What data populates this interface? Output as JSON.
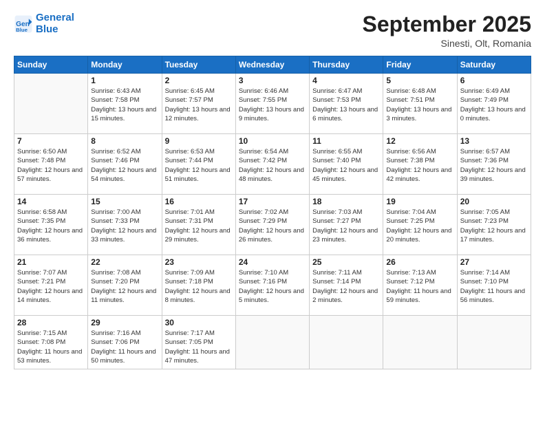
{
  "header": {
    "logo_line1": "General",
    "logo_line2": "Blue",
    "month_title": "September 2025",
    "location": "Sinesti, Olt, Romania"
  },
  "weekdays": [
    "Sunday",
    "Monday",
    "Tuesday",
    "Wednesday",
    "Thursday",
    "Friday",
    "Saturday"
  ],
  "weeks": [
    [
      {
        "day": "",
        "sunrise": "",
        "sunset": "",
        "daylight": ""
      },
      {
        "day": "1",
        "sunrise": "Sunrise: 6:43 AM",
        "sunset": "Sunset: 7:58 PM",
        "daylight": "Daylight: 13 hours and 15 minutes."
      },
      {
        "day": "2",
        "sunrise": "Sunrise: 6:45 AM",
        "sunset": "Sunset: 7:57 PM",
        "daylight": "Daylight: 13 hours and 12 minutes."
      },
      {
        "day": "3",
        "sunrise": "Sunrise: 6:46 AM",
        "sunset": "Sunset: 7:55 PM",
        "daylight": "Daylight: 13 hours and 9 minutes."
      },
      {
        "day": "4",
        "sunrise": "Sunrise: 6:47 AM",
        "sunset": "Sunset: 7:53 PM",
        "daylight": "Daylight: 13 hours and 6 minutes."
      },
      {
        "day": "5",
        "sunrise": "Sunrise: 6:48 AM",
        "sunset": "Sunset: 7:51 PM",
        "daylight": "Daylight: 13 hours and 3 minutes."
      },
      {
        "day": "6",
        "sunrise": "Sunrise: 6:49 AM",
        "sunset": "Sunset: 7:49 PM",
        "daylight": "Daylight: 13 hours and 0 minutes."
      }
    ],
    [
      {
        "day": "7",
        "sunrise": "Sunrise: 6:50 AM",
        "sunset": "Sunset: 7:48 PM",
        "daylight": "Daylight: 12 hours and 57 minutes."
      },
      {
        "day": "8",
        "sunrise": "Sunrise: 6:52 AM",
        "sunset": "Sunset: 7:46 PM",
        "daylight": "Daylight: 12 hours and 54 minutes."
      },
      {
        "day": "9",
        "sunrise": "Sunrise: 6:53 AM",
        "sunset": "Sunset: 7:44 PM",
        "daylight": "Daylight: 12 hours and 51 minutes."
      },
      {
        "day": "10",
        "sunrise": "Sunrise: 6:54 AM",
        "sunset": "Sunset: 7:42 PM",
        "daylight": "Daylight: 12 hours and 48 minutes."
      },
      {
        "day": "11",
        "sunrise": "Sunrise: 6:55 AM",
        "sunset": "Sunset: 7:40 PM",
        "daylight": "Daylight: 12 hours and 45 minutes."
      },
      {
        "day": "12",
        "sunrise": "Sunrise: 6:56 AM",
        "sunset": "Sunset: 7:38 PM",
        "daylight": "Daylight: 12 hours and 42 minutes."
      },
      {
        "day": "13",
        "sunrise": "Sunrise: 6:57 AM",
        "sunset": "Sunset: 7:36 PM",
        "daylight": "Daylight: 12 hours and 39 minutes."
      }
    ],
    [
      {
        "day": "14",
        "sunrise": "Sunrise: 6:58 AM",
        "sunset": "Sunset: 7:35 PM",
        "daylight": "Daylight: 12 hours and 36 minutes."
      },
      {
        "day": "15",
        "sunrise": "Sunrise: 7:00 AM",
        "sunset": "Sunset: 7:33 PM",
        "daylight": "Daylight: 12 hours and 33 minutes."
      },
      {
        "day": "16",
        "sunrise": "Sunrise: 7:01 AM",
        "sunset": "Sunset: 7:31 PM",
        "daylight": "Daylight: 12 hours and 29 minutes."
      },
      {
        "day": "17",
        "sunrise": "Sunrise: 7:02 AM",
        "sunset": "Sunset: 7:29 PM",
        "daylight": "Daylight: 12 hours and 26 minutes."
      },
      {
        "day": "18",
        "sunrise": "Sunrise: 7:03 AM",
        "sunset": "Sunset: 7:27 PM",
        "daylight": "Daylight: 12 hours and 23 minutes."
      },
      {
        "day": "19",
        "sunrise": "Sunrise: 7:04 AM",
        "sunset": "Sunset: 7:25 PM",
        "daylight": "Daylight: 12 hours and 20 minutes."
      },
      {
        "day": "20",
        "sunrise": "Sunrise: 7:05 AM",
        "sunset": "Sunset: 7:23 PM",
        "daylight": "Daylight: 12 hours and 17 minutes."
      }
    ],
    [
      {
        "day": "21",
        "sunrise": "Sunrise: 7:07 AM",
        "sunset": "Sunset: 7:21 PM",
        "daylight": "Daylight: 12 hours and 14 minutes."
      },
      {
        "day": "22",
        "sunrise": "Sunrise: 7:08 AM",
        "sunset": "Sunset: 7:20 PM",
        "daylight": "Daylight: 12 hours and 11 minutes."
      },
      {
        "day": "23",
        "sunrise": "Sunrise: 7:09 AM",
        "sunset": "Sunset: 7:18 PM",
        "daylight": "Daylight: 12 hours and 8 minutes."
      },
      {
        "day": "24",
        "sunrise": "Sunrise: 7:10 AM",
        "sunset": "Sunset: 7:16 PM",
        "daylight": "Daylight: 12 hours and 5 minutes."
      },
      {
        "day": "25",
        "sunrise": "Sunrise: 7:11 AM",
        "sunset": "Sunset: 7:14 PM",
        "daylight": "Daylight: 12 hours and 2 minutes."
      },
      {
        "day": "26",
        "sunrise": "Sunrise: 7:13 AM",
        "sunset": "Sunset: 7:12 PM",
        "daylight": "Daylight: 11 hours and 59 minutes."
      },
      {
        "day": "27",
        "sunrise": "Sunrise: 7:14 AM",
        "sunset": "Sunset: 7:10 PM",
        "daylight": "Daylight: 11 hours and 56 minutes."
      }
    ],
    [
      {
        "day": "28",
        "sunrise": "Sunrise: 7:15 AM",
        "sunset": "Sunset: 7:08 PM",
        "daylight": "Daylight: 11 hours and 53 minutes."
      },
      {
        "day": "29",
        "sunrise": "Sunrise: 7:16 AM",
        "sunset": "Sunset: 7:06 PM",
        "daylight": "Daylight: 11 hours and 50 minutes."
      },
      {
        "day": "30",
        "sunrise": "Sunrise: 7:17 AM",
        "sunset": "Sunset: 7:05 PM",
        "daylight": "Daylight: 11 hours and 47 minutes."
      },
      {
        "day": "",
        "sunrise": "",
        "sunset": "",
        "daylight": ""
      },
      {
        "day": "",
        "sunrise": "",
        "sunset": "",
        "daylight": ""
      },
      {
        "day": "",
        "sunrise": "",
        "sunset": "",
        "daylight": ""
      },
      {
        "day": "",
        "sunrise": "",
        "sunset": "",
        "daylight": ""
      }
    ]
  ]
}
